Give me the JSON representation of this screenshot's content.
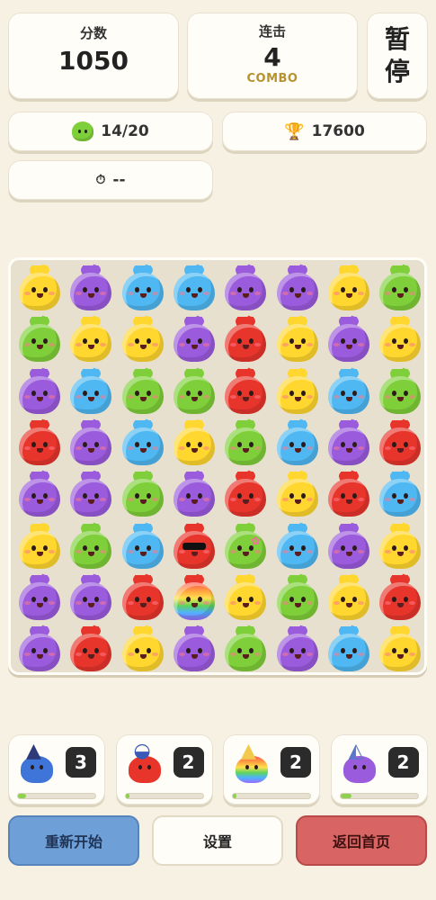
{
  "score": {
    "label": "分数",
    "value": "1050"
  },
  "combo": {
    "label": "连击",
    "value": "4",
    "sub": "COMBO"
  },
  "pause": {
    "label": "暂停"
  },
  "goal": {
    "icon": "green-blob-icon",
    "text": "14/20"
  },
  "best": {
    "icon": "trophy-icon",
    "text": "17600"
  },
  "timer": {
    "icon": "stopwatch-icon",
    "text": "--"
  },
  "colors": {
    "Y": "#ffd72e",
    "P": "#9a5bdc",
    "B": "#4fb8f2",
    "G": "#7fcf3a",
    "R": "#e8352c"
  },
  "board": [
    [
      "Y",
      "P",
      "B",
      "B",
      "P",
      "P",
      "Y",
      "G"
    ],
    [
      "G",
      "Y",
      "Y",
      "P",
      "R",
      "Y",
      "P",
      "Y"
    ],
    [
      "P",
      "B",
      "G",
      "G",
      "R",
      "Y",
      "B",
      "G"
    ],
    [
      "R",
      "P",
      "B",
      "Y",
      "G",
      "B",
      "P",
      "R"
    ],
    [
      "P",
      "P",
      "G",
      "P",
      "R",
      "Y",
      "R",
      "B"
    ],
    [
      "Y",
      "G",
      "B",
      "R*",
      "G*",
      "B",
      "P",
      "Y"
    ],
    [
      "P",
      "P",
      "R",
      "RB",
      "Y",
      "G",
      "Y",
      "R"
    ],
    [
      "P",
      "R",
      "Y",
      "P",
      "G",
      "P",
      "B",
      "Y"
    ]
  ],
  "powerups": [
    {
      "name": "wizard-blob",
      "color": "#3f74d8",
      "hat": "wizard-hat-icon",
      "count": "3",
      "progress": 0.1
    },
    {
      "name": "cap-blob",
      "color": "#e8352c",
      "hat": "cap-icon",
      "count": "2",
      "progress": 0.05
    },
    {
      "name": "party-blob",
      "color": "rainbow",
      "hat": "party-hat-icon",
      "count": "2",
      "progress": 0.05
    },
    {
      "name": "sleep-blob",
      "color": "#9a5bdc",
      "hat": "nightcap-icon",
      "count": "2",
      "progress": 0.15
    }
  ],
  "buttons": {
    "restart": "重新开始",
    "settings": "设置",
    "home": "返回首页"
  }
}
